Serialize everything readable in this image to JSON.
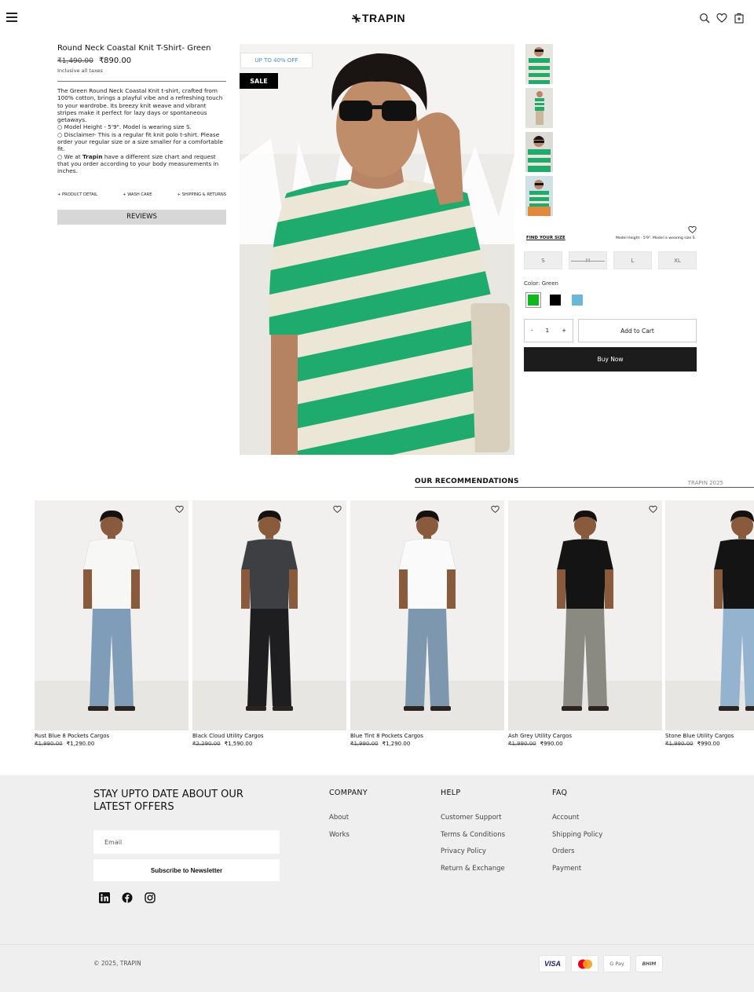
{
  "header": {
    "logo_text": "TRAPIN",
    "icons": [
      "menu-icon",
      "search-icon",
      "heart-icon",
      "cart-icon"
    ]
  },
  "product": {
    "title": "Round Neck Coastal Knit T-Shirt- Green",
    "old_price": "₹1,490.00",
    "new_price": "₹890.00",
    "tax_note": "Inclusive all taxes",
    "description": "The Green Round Neck Coastal Knit t-shirt, crafted from 100% cotton, brings a playful vibe and a refreshing touch to your wardrobe. Its breezy knit weave and vibrant stripes make it perfect for lazy days or spontaneous getaways.",
    "bullet_1": "○   Model Height - 5'9\". Model is wearing size S.",
    "bullet_2": "○   Disclaimer- This is a regular fit knit polo t-shirt. Please order your regular size or a size smaller for a comfortable fit.",
    "bullet_3_pre": "○   We at ",
    "bullet_3_brand": "Trapin",
    "bullet_3_post": " have a different size chart and request that you order according to your body measurements in inches.",
    "tabs": [
      "PRODUCT DETAIL",
      "WASH CARE",
      "SHIPPING & RETURNS"
    ],
    "reviews_label": "REVIEWS",
    "badge_discount": "UP TO 40% OFF",
    "badge_sale": "SALE",
    "stripe_colors": {
      "green": "#1faa6e",
      "cream": "#ece6d6"
    }
  },
  "purchase": {
    "find_size": "FIND YOUR SIZE",
    "model_note": "Model Height - 5'9\". Model is wearing size S.",
    "sizes": [
      "S",
      "M",
      "L",
      "XL"
    ],
    "unavailable_size": "M",
    "color_label": "Color: Green",
    "swatches": [
      "#10b81e",
      "#000000",
      "#6bb7d8"
    ],
    "qty_minus": "-",
    "qty_value": "1",
    "qty_plus": "+",
    "add_to_cart": "Add to Cart",
    "buy_now": "Buy Now"
  },
  "recommendations": {
    "title": "OUR RECOMMENDATIONS",
    "year": "TRAPIN 2025",
    "items": [
      {
        "name": "Rust Blue 8 Pockets Cargos",
        "old": "₹1,990.00",
        "price": "₹1,290.00",
        "top": "#f7f7f5",
        "pants": "#7f9cb8"
      },
      {
        "name": "Black Cloud Utility Cargos",
        "old": "₹2,290.00",
        "price": "₹1,590.00",
        "top": "#3d3f42",
        "pants": "#1e1e20"
      },
      {
        "name": "Blue Tint 8 Pockets Cargos",
        "old": "₹1,990.00",
        "price": "₹1,290.00",
        "top": "#fafafa",
        "pants": "#7d97ae"
      },
      {
        "name": "Ash Grey Utility Cargos",
        "old": "₹1,990.00",
        "price": "₹990.00",
        "top": "#141414",
        "pants": "#8a8a82"
      },
      {
        "name": "Stone Blue Utility Cargos",
        "old": "₹1,990.00",
        "price": "₹990.00",
        "top": "#141414",
        "pants": "#94b3cf"
      }
    ]
  },
  "footer": {
    "newsletter_title": "STAY UPTO DATE ABOUT OUR LATEST OFFERS",
    "email_placeholder": "Email",
    "subscribe_label": "Subscribe to Newsletter",
    "company_title": "COMPANY",
    "company_links": [
      "About",
      "Works"
    ],
    "help_title": "HELP",
    "help_links": [
      "Customer Support",
      "Terms & Conditions",
      "Privacy Policy",
      "Return & Exchange"
    ],
    "faq_title": "FAQ",
    "faq_links": [
      "Account",
      "Shipping Policy",
      "Orders",
      "Payment"
    ],
    "copyright": "© 2025, TRAPIN",
    "payments": [
      "VISA",
      "mastercard",
      "G Pay",
      "BHIM"
    ]
  }
}
